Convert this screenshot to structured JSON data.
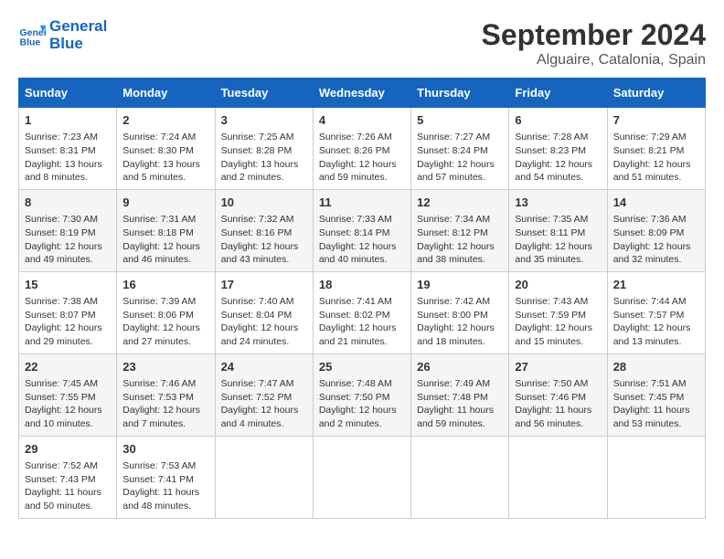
{
  "header": {
    "logo_line1": "General",
    "logo_line2": "Blue",
    "month": "September 2024",
    "location": "Alguaire, Catalonia, Spain"
  },
  "days_of_week": [
    "Sunday",
    "Monday",
    "Tuesday",
    "Wednesday",
    "Thursday",
    "Friday",
    "Saturday"
  ],
  "weeks": [
    [
      {
        "day": "1",
        "info": "Sunrise: 7:23 AM\nSunset: 8:31 PM\nDaylight: 13 hours and 8 minutes."
      },
      {
        "day": "2",
        "info": "Sunrise: 7:24 AM\nSunset: 8:30 PM\nDaylight: 13 hours and 5 minutes."
      },
      {
        "day": "3",
        "info": "Sunrise: 7:25 AM\nSunset: 8:28 PM\nDaylight: 13 hours and 2 minutes."
      },
      {
        "day": "4",
        "info": "Sunrise: 7:26 AM\nSunset: 8:26 PM\nDaylight: 12 hours and 59 minutes."
      },
      {
        "day": "5",
        "info": "Sunrise: 7:27 AM\nSunset: 8:24 PM\nDaylight: 12 hours and 57 minutes."
      },
      {
        "day": "6",
        "info": "Sunrise: 7:28 AM\nSunset: 8:23 PM\nDaylight: 12 hours and 54 minutes."
      },
      {
        "day": "7",
        "info": "Sunrise: 7:29 AM\nSunset: 8:21 PM\nDaylight: 12 hours and 51 minutes."
      }
    ],
    [
      {
        "day": "8",
        "info": "Sunrise: 7:30 AM\nSunset: 8:19 PM\nDaylight: 12 hours and 49 minutes."
      },
      {
        "day": "9",
        "info": "Sunrise: 7:31 AM\nSunset: 8:18 PM\nDaylight: 12 hours and 46 minutes."
      },
      {
        "day": "10",
        "info": "Sunrise: 7:32 AM\nSunset: 8:16 PM\nDaylight: 12 hours and 43 minutes."
      },
      {
        "day": "11",
        "info": "Sunrise: 7:33 AM\nSunset: 8:14 PM\nDaylight: 12 hours and 40 minutes."
      },
      {
        "day": "12",
        "info": "Sunrise: 7:34 AM\nSunset: 8:12 PM\nDaylight: 12 hours and 38 minutes."
      },
      {
        "day": "13",
        "info": "Sunrise: 7:35 AM\nSunset: 8:11 PM\nDaylight: 12 hours and 35 minutes."
      },
      {
        "day": "14",
        "info": "Sunrise: 7:36 AM\nSunset: 8:09 PM\nDaylight: 12 hours and 32 minutes."
      }
    ],
    [
      {
        "day": "15",
        "info": "Sunrise: 7:38 AM\nSunset: 8:07 PM\nDaylight: 12 hours and 29 minutes."
      },
      {
        "day": "16",
        "info": "Sunrise: 7:39 AM\nSunset: 8:06 PM\nDaylight: 12 hours and 27 minutes."
      },
      {
        "day": "17",
        "info": "Sunrise: 7:40 AM\nSunset: 8:04 PM\nDaylight: 12 hours and 24 minutes."
      },
      {
        "day": "18",
        "info": "Sunrise: 7:41 AM\nSunset: 8:02 PM\nDaylight: 12 hours and 21 minutes."
      },
      {
        "day": "19",
        "info": "Sunrise: 7:42 AM\nSunset: 8:00 PM\nDaylight: 12 hours and 18 minutes."
      },
      {
        "day": "20",
        "info": "Sunrise: 7:43 AM\nSunset: 7:59 PM\nDaylight: 12 hours and 15 minutes."
      },
      {
        "day": "21",
        "info": "Sunrise: 7:44 AM\nSunset: 7:57 PM\nDaylight: 12 hours and 13 minutes."
      }
    ],
    [
      {
        "day": "22",
        "info": "Sunrise: 7:45 AM\nSunset: 7:55 PM\nDaylight: 12 hours and 10 minutes."
      },
      {
        "day": "23",
        "info": "Sunrise: 7:46 AM\nSunset: 7:53 PM\nDaylight: 12 hours and 7 minutes."
      },
      {
        "day": "24",
        "info": "Sunrise: 7:47 AM\nSunset: 7:52 PM\nDaylight: 12 hours and 4 minutes."
      },
      {
        "day": "25",
        "info": "Sunrise: 7:48 AM\nSunset: 7:50 PM\nDaylight: 12 hours and 2 minutes."
      },
      {
        "day": "26",
        "info": "Sunrise: 7:49 AM\nSunset: 7:48 PM\nDaylight: 11 hours and 59 minutes."
      },
      {
        "day": "27",
        "info": "Sunrise: 7:50 AM\nSunset: 7:46 PM\nDaylight: 11 hours and 56 minutes."
      },
      {
        "day": "28",
        "info": "Sunrise: 7:51 AM\nSunset: 7:45 PM\nDaylight: 11 hours and 53 minutes."
      }
    ],
    [
      {
        "day": "29",
        "info": "Sunrise: 7:52 AM\nSunset: 7:43 PM\nDaylight: 11 hours and 50 minutes."
      },
      {
        "day": "30",
        "info": "Sunrise: 7:53 AM\nSunset: 7:41 PM\nDaylight: 11 hours and 48 minutes."
      },
      null,
      null,
      null,
      null,
      null
    ]
  ]
}
